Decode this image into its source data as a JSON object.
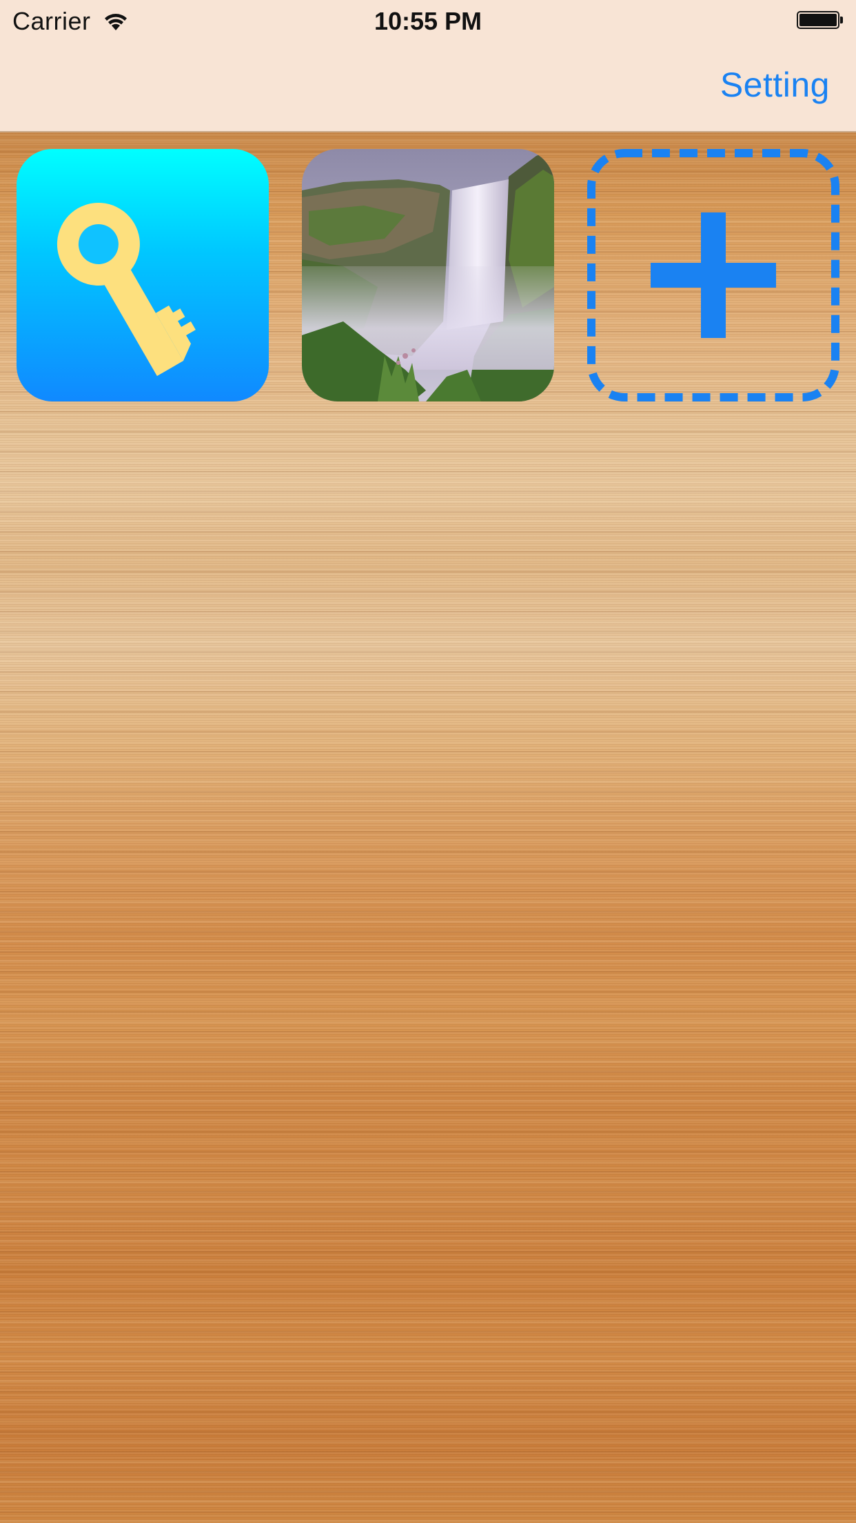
{
  "status_bar": {
    "carrier": "Carrier",
    "time": "10:55 PM",
    "wifi_icon": "wifi-icon",
    "battery_icon": "battery-icon",
    "battery_level": 1.0
  },
  "nav_bar": {
    "setting_label": "Setting"
  },
  "colors": {
    "accent": "#1a82f2",
    "key_icon": "#fde07e",
    "bar_background": "#f8e4d5"
  },
  "grid": {
    "items": [
      {
        "icon": "key-icon",
        "kind": "app"
      },
      {
        "icon": "waterfall-photo",
        "kind": "photo"
      },
      {
        "icon": "add-icon",
        "kind": "add"
      }
    ]
  }
}
